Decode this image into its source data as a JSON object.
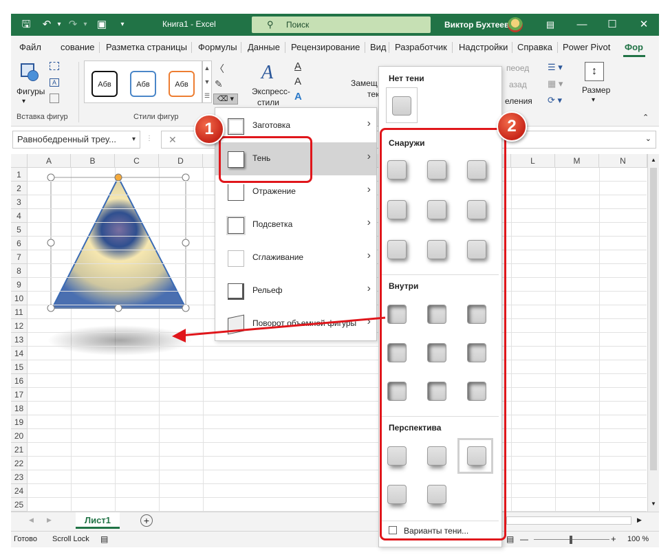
{
  "titlebar": {
    "doc_title": "Книга1  -  Excel",
    "search_placeholder": "Поиск",
    "user_name": "Виктор Бухтеев"
  },
  "tabs": [
    "Файл",
    "сование",
    "Разметка страницы",
    "Формулы",
    "Данные",
    "Рецензирование",
    "Вид",
    "Разработчик",
    "Надстройки",
    "Справка",
    "Power Pivot",
    "Фор"
  ],
  "ribbon": {
    "shapes_label": "Фигуры",
    "insert_shapes_group": "Вставка фигур",
    "styles_group": "Стили фигур",
    "style_sample": "Абв",
    "express_styles": "Экспресс-",
    "express_styles2": "стили",
    "replace_label": "Замещ",
    "replace_label2": "тек",
    "bring_forward": "пеоед",
    "send_backward": "азад",
    "selection_pane": "еления",
    "size_label": "Размер"
  },
  "formula_bar": {
    "name_box": "Равнобедренный треу...",
    "cancel_icon": "✕"
  },
  "grid": {
    "columns": [
      "A",
      "B",
      "C",
      "D",
      "",
      "",
      "",
      "",
      "",
      "",
      "L",
      "M",
      "N"
    ],
    "rows": [
      "1",
      "2",
      "3",
      "4",
      "5",
      "6",
      "7",
      "8",
      "9",
      "10",
      "11",
      "12",
      "13",
      "14",
      "15",
      "16",
      "17",
      "18",
      "19",
      "20",
      "21",
      "22",
      "23",
      "24",
      "25"
    ]
  },
  "effects_menu": {
    "items": [
      {
        "label": "Заготовка"
      },
      {
        "label": "Тень"
      },
      {
        "label": "Отражение"
      },
      {
        "label": "Подсветка"
      },
      {
        "label": "Сглаживание"
      },
      {
        "label": "Рельеф"
      },
      {
        "label": "Поворот объемной фигуры"
      }
    ],
    "active_index": 1
  },
  "shadow_gallery": {
    "no_shadow": "Нет тени",
    "outer": "Снаружи",
    "inner": "Внутри",
    "perspective": "Перспектива",
    "options": "Варианты тени..."
  },
  "annotations": {
    "badge1": "1",
    "badge2": "2",
    "color": "#e0161b"
  },
  "sheets": {
    "active": "Лист1"
  },
  "status": {
    "ready": "Готово",
    "scroll_lock": "Scroll Lock",
    "zoom": "100 %"
  },
  "colors": {
    "excel_green": "#217346",
    "ribbon_bg": "#f3f3f3"
  }
}
